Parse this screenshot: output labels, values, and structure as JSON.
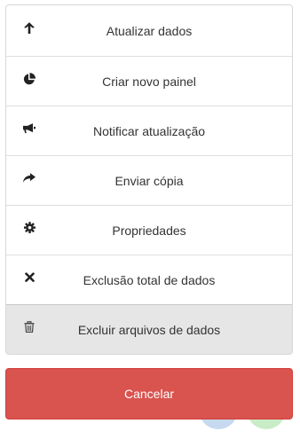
{
  "menu": {
    "items": [
      {
        "label": "Atualizar dados",
        "icon": "arrow-up-icon"
      },
      {
        "label": "Criar novo painel",
        "icon": "pie-chart-icon"
      },
      {
        "label": "Notificar atualização",
        "icon": "bullhorn-icon"
      },
      {
        "label": "Enviar cópia",
        "icon": "share-icon"
      },
      {
        "label": "Propriedades",
        "icon": "gear-icon"
      },
      {
        "label": "Exclusão total de dados",
        "icon": "close-icon"
      },
      {
        "label": "Excluir arquivos de dados",
        "icon": "trash-icon"
      }
    ]
  },
  "cancel_label": "Cancelar",
  "colors": {
    "cancel_bg": "#d9534f",
    "text": "#333333",
    "highlight_bg": "#e6e6e6"
  }
}
